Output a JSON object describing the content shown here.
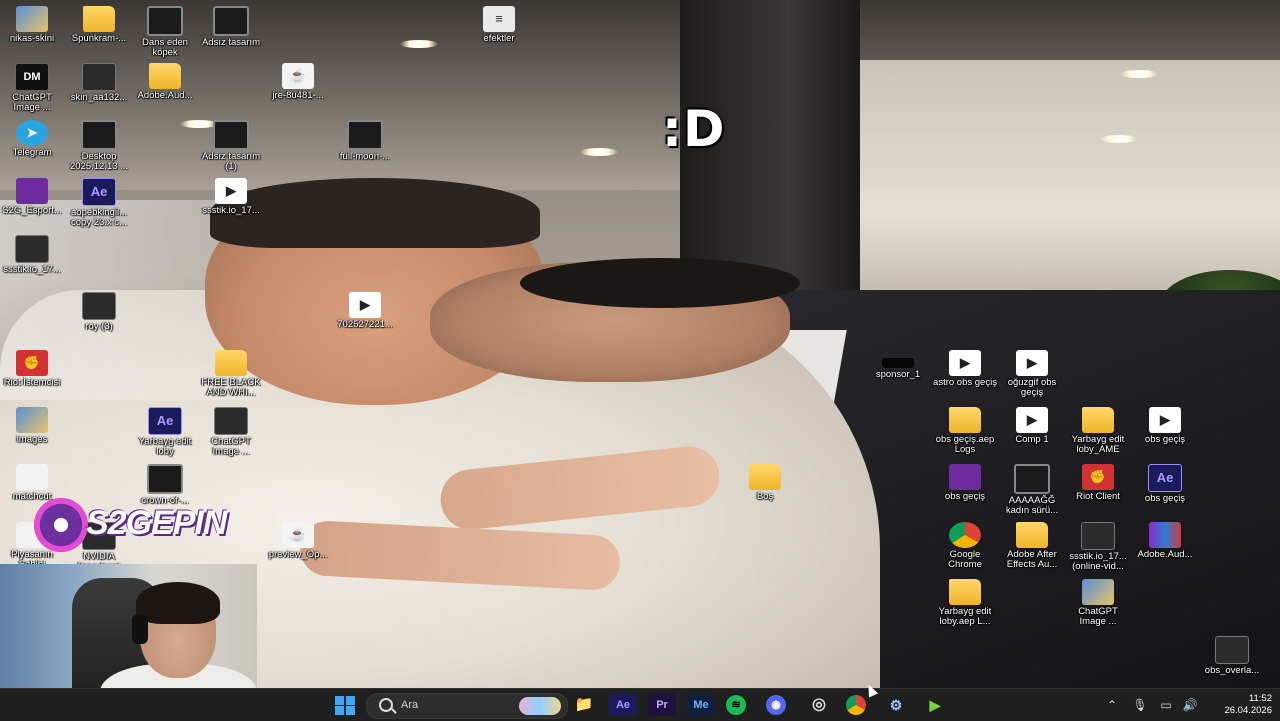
{
  "wallpaper_caption": ":D",
  "desktop_icons": [
    {
      "label": "nikas-skini",
      "icon": "image-icon"
    },
    {
      "label": "Spunkram-...",
      "icon": "folder-icon"
    },
    {
      "label": "Dans eden köpek",
      "icon": "video-icon"
    },
    {
      "label": "Adsız tasarım",
      "icon": "video-icon"
    },
    {
      "label": "efektler",
      "icon": "folder-icon"
    },
    {
      "label": "ChatGPT Image ...",
      "icon": "image-icon"
    },
    {
      "label": "skin_aa132...",
      "icon": "image-icon"
    },
    {
      "label": "Adobe.Aud...",
      "icon": "folder-icon"
    },
    {
      "label": "jre-8u481-...",
      "icon": "java-icon"
    },
    {
      "label": "Telegram",
      "icon": "telegram-icon"
    },
    {
      "label": "Desktop 2025.12.13 ...",
      "icon": "video-icon"
    },
    {
      "label": "Adsız tasarım (1)",
      "icon": "video-icon"
    },
    {
      "label": "full-moon-...",
      "icon": "video-icon"
    },
    {
      "label": "S2G_Esport...",
      "icon": "image-icon"
    },
    {
      "label": "aopebkingil... copy 23.x c...",
      "icon": "after-effects-icon"
    },
    {
      "label": "ssstik.io_17...",
      "icon": "obs-icon"
    },
    {
      "label": "ssstik.io_17...",
      "icon": "video-icon"
    },
    {
      "label": "roy (3)",
      "icon": "image-icon"
    },
    {
      "label": "702527221...",
      "icon": "obs-icon"
    },
    {
      "label": "Riot İstemcisi",
      "icon": "riot-icon"
    },
    {
      "label": "FREE BLACK AND WHI...",
      "icon": "folder-icon"
    },
    {
      "label": "images",
      "icon": "image-icon"
    },
    {
      "label": "Yarbayg edit loby",
      "icon": "after-effects-icon"
    },
    {
      "label": "ChatGPT Image ...",
      "icon": "image-icon"
    },
    {
      "label": "matchcut",
      "icon": "file-icon"
    },
    {
      "label": "crown-of-...",
      "icon": "video-icon"
    },
    {
      "label": "Piyasanın Sahibi",
      "icon": "file-icon"
    },
    {
      "label": "NVIDIA Broadcast",
      "icon": "app-icon"
    },
    {
      "label": "preview_Op...",
      "icon": "java-icon"
    },
    {
      "label": "Boş",
      "icon": "folder-icon"
    },
    {
      "label": "sponsor_1",
      "icon": "image-icon"
    },
    {
      "label": "astro obs geçiş",
      "icon": "obs-icon"
    },
    {
      "label": "oğuzgif obs geçiş",
      "icon": "obs-icon"
    },
    {
      "label": "obs geçiş.aep Logs",
      "icon": "folder-icon"
    },
    {
      "label": "Comp 1",
      "icon": "obs-icon"
    },
    {
      "label": "Yarbayg edit loby_AME",
      "icon": "folder-icon"
    },
    {
      "label": "obs geçiş",
      "icon": "obs-icon"
    },
    {
      "label": "obs geçiş",
      "icon": "video-icon"
    },
    {
      "label": "AAAAAĞĞ kadın sürü...",
      "icon": "video-icon"
    },
    {
      "label": "Riot Client",
      "icon": "riot-icon"
    },
    {
      "label": "obs geçiş",
      "icon": "after-effects-icon"
    },
    {
      "label": "Google Chrome",
      "icon": "chrome-icon"
    },
    {
      "label": "Adobe After Effects Au...",
      "icon": "folder-icon"
    },
    {
      "label": "ssstik.io_17... (online-vid...",
      "icon": "video-icon"
    },
    {
      "label": "Adobe.Aud...",
      "icon": "winrar-icon"
    },
    {
      "label": "Yarbayg edit loby.aep L...",
      "icon": "folder-icon"
    },
    {
      "label": "ChatGPT Image ...",
      "icon": "image-icon"
    },
    {
      "label": "obs_overla...",
      "icon": "image-icon"
    }
  ],
  "stream_logo": {
    "text": "S2GEPIN"
  },
  "taskbar": {
    "search_placeholder": "Ara",
    "pinned": [
      {
        "name": "file-explorer-icon",
        "glyph": "📁"
      },
      {
        "name": "after-effects-icon",
        "glyph": "Ae"
      },
      {
        "name": "premiere-pro-icon",
        "glyph": "Pr"
      },
      {
        "name": "media-encoder-icon",
        "glyph": "Me"
      },
      {
        "name": "spotify-icon",
        "glyph": "≋"
      },
      {
        "name": "discord-icon",
        "glyph": "◉"
      },
      {
        "name": "obs-icon",
        "glyph": "◎"
      },
      {
        "name": "chrome-icon",
        "glyph": ""
      },
      {
        "name": "steam-icon",
        "glyph": "⚙"
      },
      {
        "name": "green-app-icon",
        "glyph": "▶"
      }
    ],
    "clock": {
      "time": "11:52",
      "date": "26.04.2026"
    }
  }
}
